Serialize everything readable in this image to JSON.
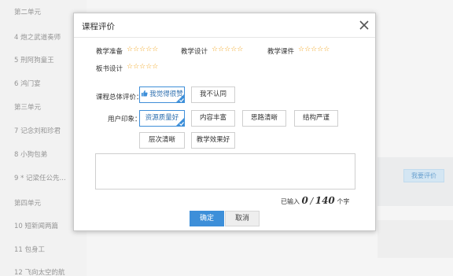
{
  "sidebar": {
    "items": [
      "第二单元",
      "4 炮之武道奏师",
      "5 刑阿狗童王",
      "6 鸿门宴",
      "第三单元",
      "7 记念刘和珍君",
      "8 小狗包弟",
      "9 * 记梁任公先...",
      "第四单元",
      "10 短新闻两篇",
      "11 包身工",
      "12 飞向太空的航"
    ]
  },
  "background": {
    "evaluate_button": "我要评价"
  },
  "dialog": {
    "title": "课程评价",
    "ratings": [
      {
        "label": "教学准备",
        "stars": "☆☆☆☆☆"
      },
      {
        "label": "教学设计",
        "stars": "☆☆☆☆☆"
      },
      {
        "label": "教学课件",
        "stars": "☆☆☆☆☆"
      },
      {
        "label": "板书设计",
        "stars": "☆☆☆☆☆"
      }
    ],
    "overall_label": "课程总体评价：",
    "overall_options": [
      "我觉得很赞",
      "我不认同"
    ],
    "impression_label": "用户印象：",
    "impression_tags": [
      "资源质量好",
      "内容丰富",
      "思路清晰",
      "结构严谨",
      "层次清晰",
      "教学效果好"
    ],
    "textarea_placeholder": "",
    "counter": {
      "prefix": "已输入",
      "current": "0",
      "separator": "/",
      "max": "140",
      "suffix": "个字"
    },
    "confirm": "确定",
    "cancel": "取消"
  },
  "colors": {
    "accent": "#3d8fd9",
    "star": "#f1a31a"
  }
}
